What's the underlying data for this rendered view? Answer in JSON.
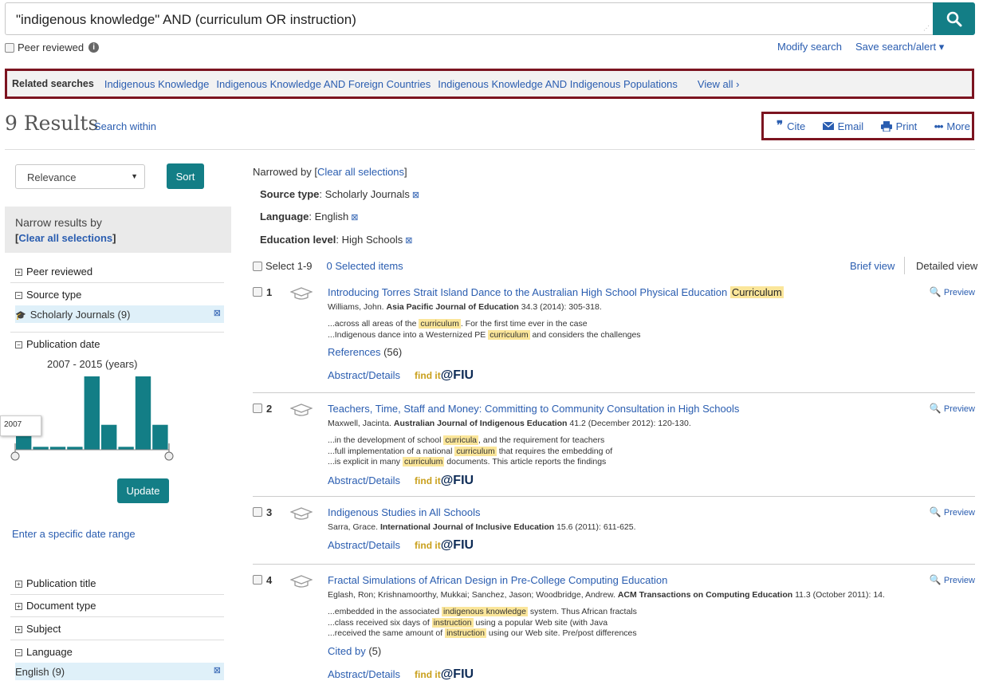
{
  "search": {
    "query": "\"indigenous knowledge\" AND (curriculum OR instruction)"
  },
  "peer_reviewed_label": "Peer reviewed",
  "modify_search": "Modify search",
  "save_search": "Save search/alert ▾",
  "related": {
    "label": "Related searches",
    "items": [
      "Indigenous Knowledge",
      "Indigenous Knowledge AND Foreign Countries",
      "Indigenous Knowledge AND Indigenous Populations"
    ],
    "view_all": "View all ›"
  },
  "results_count": "9 Results",
  "search_within": "Search within",
  "actions": {
    "cite": "Cite",
    "email": "Email",
    "print": "Print",
    "more": "More"
  },
  "sort": {
    "selected": "Relevance",
    "button": "Sort"
  },
  "narrow": {
    "title": "Narrow results by",
    "clear": "Clear all selections"
  },
  "facets": {
    "peer_reviewed": "Peer reviewed",
    "source_type": "Source type",
    "source_type_value": "Scholarly Journals (9)",
    "pub_date": "Publication date",
    "date_range": "2007 - 2015 (years)",
    "tooltip": "2007",
    "update": "Update",
    "specific_range": "Enter a specific date range",
    "pub_title": "Publication title",
    "doc_type": "Document type",
    "subject": "Subject",
    "language": "Language",
    "language_value": "English (9)"
  },
  "histogram": [
    1,
    0.2,
    0.2,
    0.2,
    5,
    1.7,
    0.2,
    5,
    1.7
  ],
  "narrowed": {
    "label": "Narrowed by",
    "clear": "Clear all selections",
    "filters": [
      {
        "name": "Source type",
        "value": "Scholarly Journals"
      },
      {
        "name": "Language",
        "value": "English"
      },
      {
        "name": "Education level",
        "value": "High Schools"
      }
    ]
  },
  "list": {
    "select": "Select 1-9",
    "selected": "0 Selected items",
    "brief": "Brief view",
    "detailed": "Detailed view"
  },
  "records": [
    {
      "num": "1",
      "title": "Introducing Torres Strait Island Dance to the Australian High School Physical Education ",
      "title_hl": "Curriculum",
      "author": "Williams, John.",
      "journal": "Asia Pacific Journal of Education",
      "details": " 34.3  (2014): 305-318.",
      "snippets": [
        {
          "pre": "...across all areas of the ",
          "hl": "curriculum",
          "post": ". For the first time ever in the case"
        },
        {
          "pre": "...Indigenous dance into a Westernized PE ",
          "hl": "curriculum",
          "post": " and considers the challenges"
        }
      ],
      "extra_link": "References",
      "extra_count": " (56)"
    },
    {
      "num": "2",
      "title": "Teachers, Time, Staff and Money: Committing to Community Consultation in High Schools",
      "title_hl": "",
      "author": "Maxwell, Jacinta.",
      "journal": "Australian Journal of Indigenous Education",
      "details": " 41.2  (December 2012): 120-130.",
      "snippets": [
        {
          "pre": "...in the development of school ",
          "hl": "curricula",
          "post": ", and the requirement for teachers"
        },
        {
          "pre": "...full implementation of a national ",
          "hl": "curriculum",
          "post": " that requires the embedding of"
        },
        {
          "pre": "...is explicit in many ",
          "hl": "curriculum",
          "post": " documents. This article reports the findings"
        }
      ],
      "extra_link": "",
      "extra_count": ""
    },
    {
      "num": "3",
      "title": "Indigenous Studies in All Schools",
      "title_hl": "",
      "author": "Sarra, Grace.",
      "journal": "International Journal of Inclusive Education",
      "details": " 15.6  (2011): 611-625.",
      "snippets": [],
      "extra_link": "",
      "extra_count": ""
    },
    {
      "num": "4",
      "title": "Fractal Simulations of African Design in Pre-College Computing Education",
      "title_hl": "",
      "author": "Eglash, Ron; Krishnamoorthy, Mukkai; Sanchez, Jason; Woodbridge, Andrew.",
      "journal": "ACM Transactions on Computing Education",
      "details": " 11.3  (October 2011): 14.",
      "snippets": [
        {
          "pre": "...embedded in the associated ",
          "hl": "indigenous knowledge",
          "post": " system. Thus African fractals"
        },
        {
          "pre": "...class received six days of ",
          "hl": "instruction",
          "post": " using a popular Web site (with Java"
        },
        {
          "pre": "...received the same amount of ",
          "hl": "instruction",
          "post": " using our Web site. Pre/post differences"
        }
      ],
      "extra_link": "Cited by",
      "extra_count": " (5)"
    }
  ],
  "record_links": {
    "abstract": "Abstract/Details",
    "findit": "find it",
    "fiu": "@FIU",
    "preview": "Preview"
  }
}
